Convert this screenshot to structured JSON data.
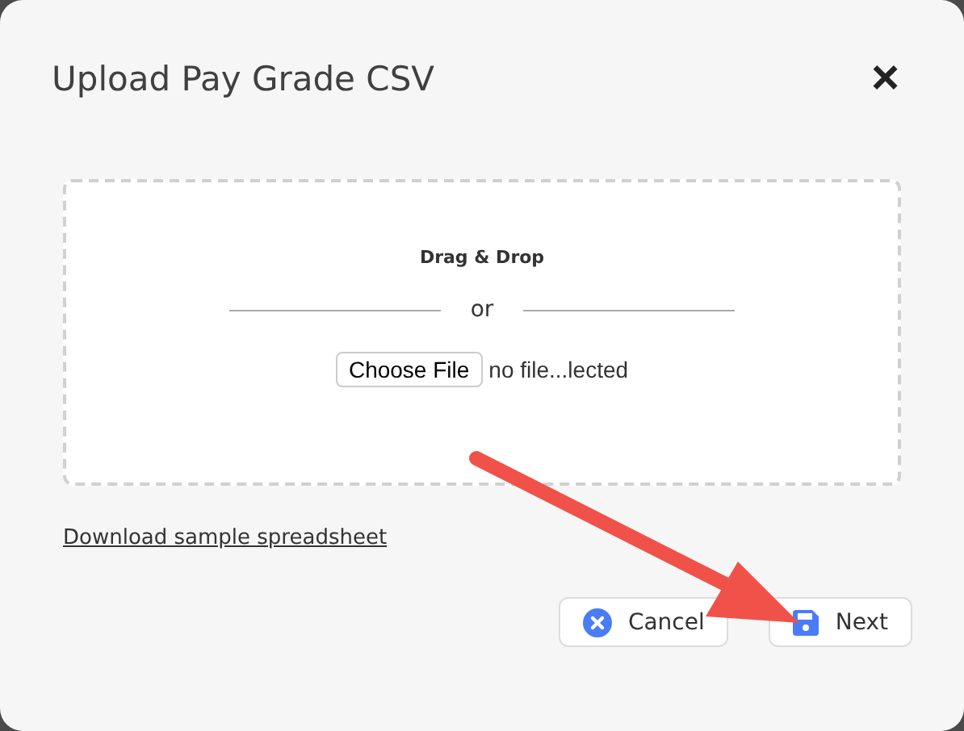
{
  "dialog": {
    "title": "Upload Pay Grade CSV",
    "close": "×"
  },
  "dropzone": {
    "heading": "Drag & Drop",
    "separator": "or",
    "choose_button": "Choose File",
    "file_status": "no file...lected"
  },
  "link": "Download sample spreadsheet",
  "buttons": [
    {
      "kind": "cancel",
      "label": "Cancel"
    },
    {
      "kind": "save",
      "label": "Next"
    }
  ]
}
